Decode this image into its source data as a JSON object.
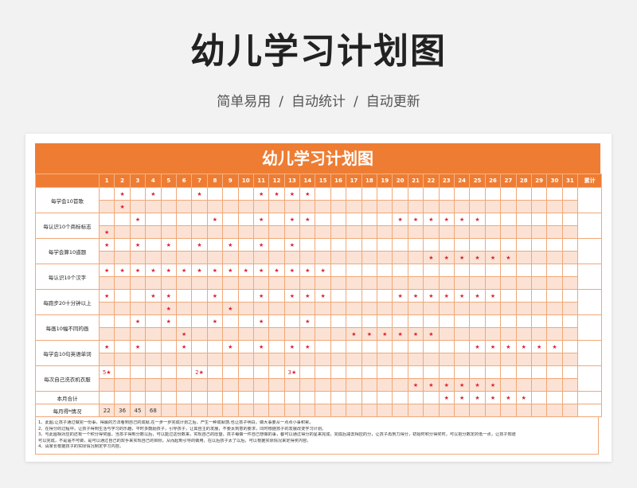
{
  "page": {
    "title": "幼儿学习计划图",
    "subtitle_parts": [
      "简单易用",
      "自动统计",
      "自动更新"
    ],
    "separator": "/"
  },
  "sheet": {
    "banner": "幼儿学习计划图",
    "days": [
      "1",
      "2",
      "3",
      "4",
      "5",
      "6",
      "7",
      "8",
      "9",
      "10",
      "11",
      "12",
      "13",
      "14",
      "15",
      "16",
      "17",
      "18",
      "19",
      "20",
      "21",
      "22",
      "23",
      "24",
      "25",
      "26",
      "27",
      "28",
      "29",
      "30",
      "31"
    ],
    "total_header": "累计",
    "star": "★",
    "tasks": [
      {
        "label": "每学会10首歌",
        "rows": [
          [
            2,
            4,
            7,
            11,
            12,
            13,
            14
          ],
          [
            2
          ]
        ]
      },
      {
        "label": "每认识10个商标标志",
        "rows": [
          [
            3,
            8,
            11,
            13,
            14,
            20,
            21,
            22,
            23,
            24,
            25
          ],
          [
            1
          ]
        ]
      },
      {
        "label": "每学会算10道题",
        "rows": [
          [
            1,
            3,
            5,
            7,
            9,
            11,
            13
          ],
          [
            22,
            23,
            24,
            25,
            26,
            27
          ]
        ]
      },
      {
        "label": "每认识10个汉字",
        "rows": [
          [
            1,
            2,
            3,
            4,
            5,
            6,
            7,
            8,
            9,
            10,
            11,
            12,
            13,
            14,
            15
          ],
          []
        ]
      },
      {
        "label": "每跑步20十分钟以上",
        "rows": [
          [
            1,
            4,
            5,
            8,
            11,
            13,
            14,
            15,
            20,
            21,
            22,
            23,
            24,
            25,
            26
          ],
          [
            5,
            9
          ]
        ]
      },
      {
        "label": "每画10幅不同的画",
        "rows": [
          [
            3,
            5,
            8,
            11,
            14
          ],
          [
            6,
            17,
            18,
            19,
            20,
            21,
            22
          ]
        ]
      },
      {
        "label": "每学会10句英语单词",
        "rows": [
          [
            1,
            3,
            6,
            9,
            11,
            13,
            14,
            25,
            26,
            27,
            28,
            29,
            30
          ],
          []
        ]
      },
      {
        "label": "每次自己洗衣机衣服",
        "rows": [
          [],
          [
            21,
            22,
            23,
            24,
            25,
            26
          ]
        ]
      }
    ],
    "marks": [
      {
        "task": 7,
        "row": 0,
        "day": 1,
        "text": "5★"
      },
      {
        "task": 7,
        "row": 0,
        "day": 7,
        "text": "2★"
      },
      {
        "task": 7,
        "row": 0,
        "day": 13,
        "text": "3★"
      }
    ],
    "monthly_total_label": "本月合计",
    "monthly_total_stars": [
      23,
      24,
      25,
      26,
      27,
      28
    ],
    "monthly_status_label": "每月得*情况",
    "monthly_status_values": [
      "22",
      "36",
      "45",
      "68"
    ]
  },
  "notes": [
    "1、此图,让孩子通过做完一份事，得最的方法看到自己的成就,在一步一步完成计划之后，产生一种成就感,也让孩子明白，做大事要从一点点小事积累。",
    "2、在得分的过程中，让孩子得到生活与学习的乐趣，平时多鼓励孩子，引导孩子，让其自主的发展，不要太刻意的要求，同时根据孩子的发展改变学习计划。",
    "3、与此图相对应的还有一个积分得奖图，当孩子得到分数以后，可以能过这份数来，实现自己的愿望，孩子每做一件自己想做的事，都可以通过得分的星来完成，完成后减去相应的分，让孩子再努力得分，初始时积分得奖时，可以把分数定的低一点，让孩子知道",
    "可以完成，不是遥不可做，是可以通过自己的双手来实现自己的目标，从而起到引导的做用，在以后孩子太了以后，可以根据实际情况来定得奖内容。",
    "4、请家长根据孩子的实际情况制定学习内容。"
  ]
}
